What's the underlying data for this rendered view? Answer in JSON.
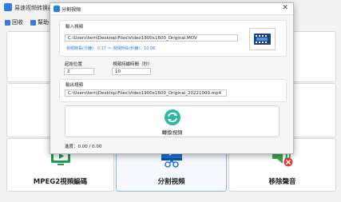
{
  "main": {
    "title": "易速视频转换器PRO",
    "menu": [
      {
        "label": "回收",
        "icon": "recycle-icon"
      },
      {
        "label": "幫助",
        "icon": "help-icon"
      }
    ],
    "tools": [
      {
        "label": "MPEG2視頻編碼",
        "icon": "mpeg2-icon"
      },
      {
        "label": "分割視頻",
        "icon": "split-video-icon"
      },
      {
        "label": "移除聲音",
        "icon": "remove-audio-icon"
      }
    ]
  },
  "dialog": {
    "title": "分割視頻",
    "input_label": "輸入視頻",
    "input_path": "C:\\Users\\tern\\Desktop\\Files\\Video1900x1600_Original.MOV",
    "duration_info": "視頻時長(分鐘)：0.17 ＝ 視頻時長(秒鐘)：10.06",
    "start_label": "起始位置",
    "start_value": "2",
    "duration_label": "視頻持續時間（秒）",
    "duration_value": "10",
    "output_label": "輸出視頻",
    "output_path": "C:\\Users\\tern\\Desktop\\Files\\Video1900x1600_Original_20221009.mp4",
    "convert_label": "轉換視頻",
    "progress": "進度：0.00 / 0.00"
  },
  "colors": {
    "accent": "#2e7de0",
    "convert_icon": "#2fb7a3",
    "mpeg2_icon": "#1f9d55",
    "remove_audio_icon": "#3aa84a",
    "remove_badge": "#e53935"
  }
}
